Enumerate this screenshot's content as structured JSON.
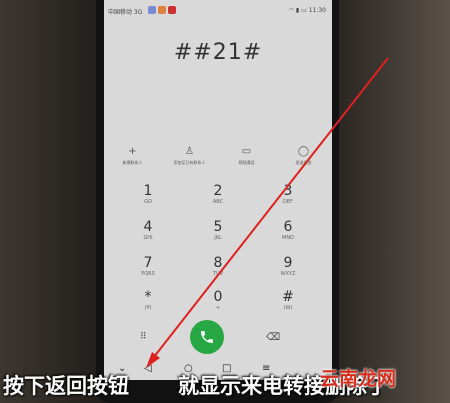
{
  "status_bar": {
    "carrier": "中国移动 3G",
    "time": "11:30"
  },
  "dialer": {
    "number": "##21#",
    "actions": [
      {
        "icon": "plus-icon",
        "glyph": "+",
        "label": "新建联系人"
      },
      {
        "icon": "person-add-icon",
        "glyph": "♙",
        "label": "添加至已有联系人"
      },
      {
        "icon": "video-icon",
        "glyph": "▭",
        "label": "视频通话"
      },
      {
        "icon": "message-icon",
        "glyph": "◯",
        "label": "发送信息"
      }
    ],
    "keys": [
      {
        "digit": "1",
        "letters": "GO"
      },
      {
        "digit": "2",
        "letters": "ABC"
      },
      {
        "digit": "3",
        "letters": "DEF"
      },
      {
        "digit": "4",
        "letters": "GHI"
      },
      {
        "digit": "5",
        "letters": "JKL"
      },
      {
        "digit": "6",
        "letters": "MNO"
      },
      {
        "digit": "7",
        "letters": "PQRS"
      },
      {
        "digit": "8",
        "letters": "TUV"
      },
      {
        "digit": "9",
        "letters": "WXYZ"
      },
      {
        "digit": "*",
        "letters": "(P)"
      },
      {
        "digit": "0",
        "letters": "+"
      },
      {
        "digit": "#",
        "letters": "(W)"
      }
    ],
    "bottom": {
      "dialpad_glyph": "⠿",
      "call_color": "#28a745",
      "delete_glyph": "⌫"
    }
  },
  "navbar": {
    "down": "⌄",
    "back": "◁",
    "home": "○",
    "recent": "□",
    "menu": "≡"
  },
  "caption": {
    "part1": "按下返回按钮",
    "part2": "就显示来电转接删除了"
  },
  "watermark": "云南龙网",
  "colors": {
    "caption_text": "#ffffff",
    "watermark": "#d62a1a",
    "arrow_line": "#e02020"
  }
}
